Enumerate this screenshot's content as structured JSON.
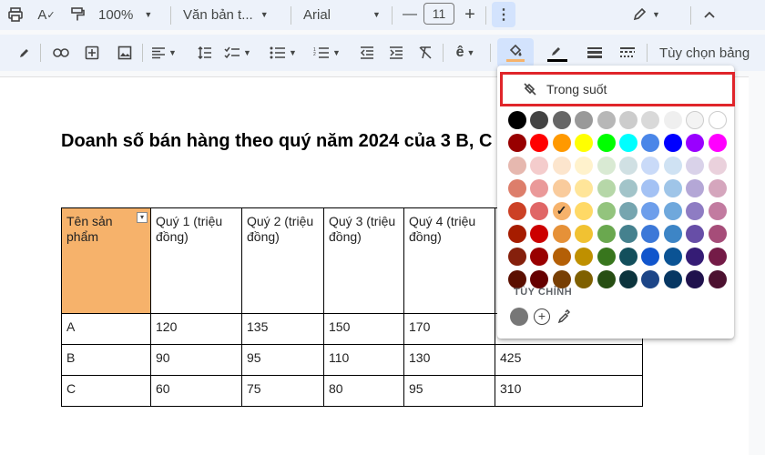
{
  "toolbar1": {
    "zoom": "100%",
    "style": "Văn bản t...",
    "font": "Arial",
    "font_size": "11",
    "minus": "—",
    "plus": "+"
  },
  "toolbar2": {
    "table_options": "Tùy chọn bảng"
  },
  "document": {
    "title": "Doanh số bán hàng theo quý năm 2024 của 3 B, C",
    "table": {
      "headers": [
        "Tên sản phẩm",
        "Quý 1 (triệu đồng)",
        "Quý 2 (triệu đồng)",
        "Quý 3 (triệu đồng)",
        "Quý 4 (triệu đồng)",
        ""
      ],
      "rows": [
        [
          "A",
          "120",
          "135",
          "150",
          "170",
          ""
        ],
        [
          "B",
          "90",
          "95",
          "110",
          "130",
          "425"
        ],
        [
          "C",
          "60",
          "75",
          "80",
          "95",
          "310"
        ]
      ]
    }
  },
  "color_popup": {
    "transparent_label": "Trong suốt",
    "custom_label": "TÙY CHỈNH",
    "colors": [
      [
        "#000000",
        "#434343",
        "#666666",
        "#999999",
        "#b7b7b7",
        "#cccccc",
        "#d9d9d9",
        "#efefef",
        "#f3f3f3",
        "#ffffff"
      ],
      [
        "#980000",
        "#ff0000",
        "#ff9900",
        "#ffff00",
        "#00ff00",
        "#00ffff",
        "#4a86e8",
        "#0000ff",
        "#9900ff",
        "#ff00ff"
      ],
      [
        "#e6b8af",
        "#f4cccc",
        "#fce5cd",
        "#fff2cc",
        "#d9ead3",
        "#d0e0e3",
        "#c9daf8",
        "#cfe2f3",
        "#d9d2e9",
        "#ead1dc"
      ],
      [
        "#dd7e6b",
        "#ea9999",
        "#f9cb9c",
        "#ffe599",
        "#b6d7a8",
        "#a2c4c9",
        "#a4c2f4",
        "#9fc5e8",
        "#b4a7d6",
        "#d5a6bd"
      ],
      [
        "#cc4125",
        "#e06666",
        "#f6b26b",
        "#ffd966",
        "#93c47d",
        "#76a5af",
        "#6d9eeb",
        "#6fa8dc",
        "#8e7cc3",
        "#c27ba0"
      ],
      [
        "#a61c00",
        "#cc0000",
        "#e69138",
        "#f1c232",
        "#6aa84f",
        "#45818e",
        "#3c78d8",
        "#3d85c6",
        "#674ea7",
        "#a64d79"
      ],
      [
        "#85200c",
        "#990000",
        "#b45f06",
        "#bf9000",
        "#38761d",
        "#134f5c",
        "#1155cc",
        "#0b5394",
        "#351c75",
        "#741b47"
      ],
      [
        "#5b0f00",
        "#660000",
        "#783f04",
        "#7f6000",
        "#274e13",
        "#0c343d",
        "#1c4587",
        "#073763",
        "#20124d",
        "#4c1130"
      ]
    ],
    "selected": "#f6b26b",
    "custom_color": "#777777"
  }
}
